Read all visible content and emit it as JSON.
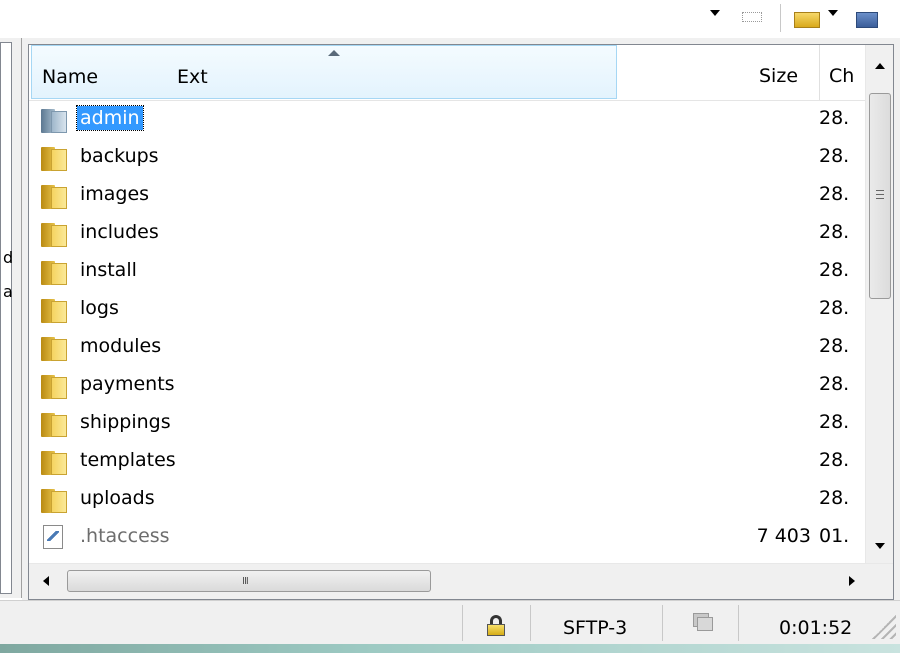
{
  "columns": {
    "name": "Name",
    "ext": "Ext",
    "size": "Size",
    "changed": "Ch"
  },
  "files": [
    {
      "name": "admin",
      "kind": "folder",
      "size": "",
      "changed": "28.",
      "selected": true
    },
    {
      "name": "backups",
      "kind": "folder",
      "size": "",
      "changed": "28."
    },
    {
      "name": "images",
      "kind": "folder",
      "size": "",
      "changed": "28."
    },
    {
      "name": "includes",
      "kind": "folder",
      "size": "",
      "changed": "28."
    },
    {
      "name": "install",
      "kind": "folder",
      "size": "",
      "changed": "28."
    },
    {
      "name": "logs",
      "kind": "folder",
      "size": "",
      "changed": "28."
    },
    {
      "name": "modules",
      "kind": "folder",
      "size": "",
      "changed": "28."
    },
    {
      "name": "payments",
      "kind": "folder",
      "size": "",
      "changed": "28."
    },
    {
      "name": "shippings",
      "kind": "folder",
      "size": "",
      "changed": "28."
    },
    {
      "name": "templates",
      "kind": "folder",
      "size": "",
      "changed": "28."
    },
    {
      "name": "uploads",
      "kind": "folder",
      "size": "",
      "changed": "28."
    },
    {
      "name": ".htaccess",
      "kind": "file",
      "size": "7 403",
      "changed": "01."
    }
  ],
  "left_pane": {
    "fragments": [
      "d",
      "a"
    ]
  },
  "hscroll_grip": "III",
  "status": {
    "protocol": "SFTP-3",
    "elapsed": "0:01:52"
  },
  "colors": {
    "selection": "#3399ff",
    "folder": "#f5d460",
    "header_hover": "#e3f3fd"
  }
}
